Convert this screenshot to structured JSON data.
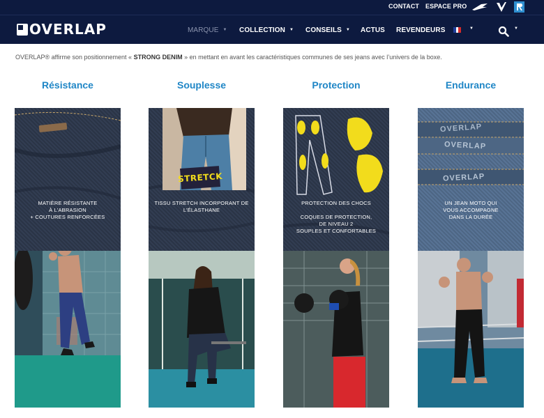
{
  "topbar": {
    "contact": "CONTACT",
    "espace_pro": "ESPACE PRO",
    "icons": [
      "brand-swoosh-icon",
      "brand-v-icon",
      "brand-r-icon"
    ]
  },
  "nav": {
    "logo_text": "OVERLAP",
    "items": [
      {
        "label": "MARQUE",
        "has_menu": true,
        "active": false
      },
      {
        "label": "COLLECTION",
        "has_menu": true
      },
      {
        "label": "CONSEILS",
        "has_menu": true
      },
      {
        "label": "ACTUS",
        "has_menu": false
      },
      {
        "label": "REVENDEURS",
        "has_menu": false
      }
    ],
    "language_flag_colors": [
      "#1f3e9a",
      "#ffffff",
      "#d62b2b"
    ],
    "caret": "▼"
  },
  "intro": {
    "before": "OVERLAP® affirme son positionnement « ",
    "strong": "STRONG DENIM",
    "after": " » en mettant en avant les caractéristiques communes de ses jeans avec l’univers de la boxe."
  },
  "columns": [
    {
      "title": "Résistance",
      "lines": [
        "MATIÈRE RÉSISTANTE",
        "À L’ABRASION",
        "+ COUTURES RENFORCÉES"
      ]
    },
    {
      "title": "Souplesse",
      "badge": "STRETCK",
      "lines": [
        "TISSU STRETCH INCORPORANT DE",
        "L’ÉLASTHANE"
      ]
    },
    {
      "title": "Protection",
      "lines": [
        "PROTECTION DES CHOCS",
        "",
        "COQUES DE PROTECTION,",
        "DE NIVEAU 2",
        "SOUPLES ET CONFORTABLES"
      ]
    },
    {
      "title": "Endurance",
      "labels": [
        "OVERLAP",
        "OVERLAP",
        "OVERLAP"
      ],
      "lines": [
        "UN JEAN MOTO QUI",
        "VOUS ACCOMPAGNE",
        "DANS LA DURÉE"
      ]
    }
  ],
  "colors": {
    "nav_bg": "#0d1a3f",
    "title_blue": "#1f86c6",
    "pad_yellow": "#f2dc1c"
  }
}
